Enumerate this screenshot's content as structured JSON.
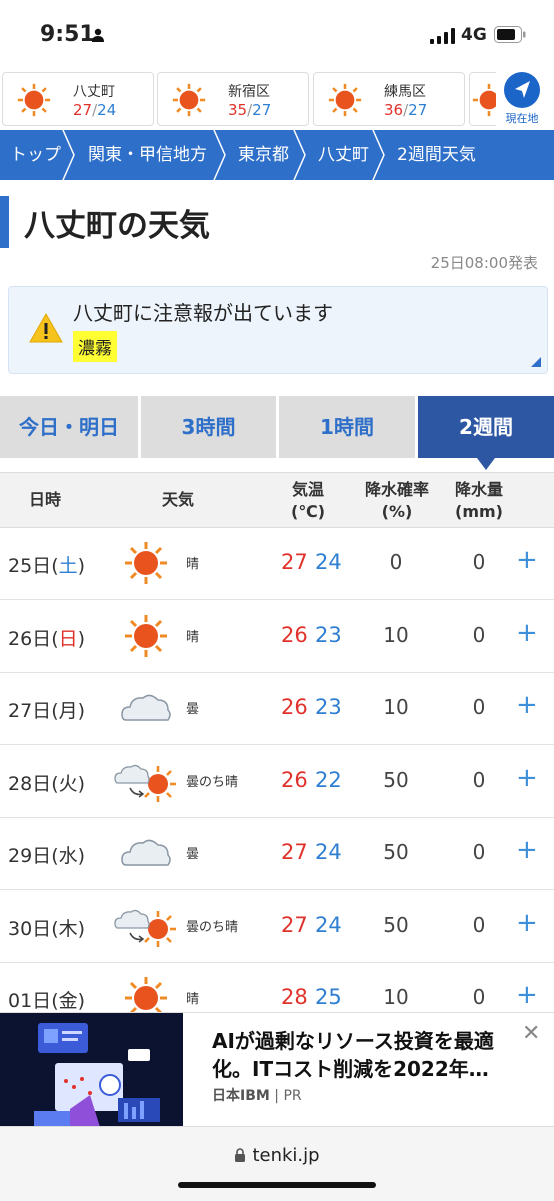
{
  "status_bar": {
    "time": "9:51",
    "network": "4G"
  },
  "locations": [
    {
      "name": "八丈町",
      "high": "27",
      "low": "24"
    },
    {
      "name": "新宿区",
      "high": "35",
      "low": "27"
    },
    {
      "name": "練馬区",
      "high": "36",
      "low": "27"
    }
  ],
  "current_location_label": "現在地",
  "breadcrumb": [
    "トップ",
    "関東・甲信地方",
    "東京都",
    "八丈町",
    "2週間天気"
  ],
  "page_title": "八丈町の天気",
  "issued": "25日08:00発表",
  "alert": {
    "message": "八丈町に注意報が出ています",
    "badge": "濃霧"
  },
  "tabs": [
    {
      "label": "今日・明日",
      "active": false
    },
    {
      "label": "3時間",
      "active": false
    },
    {
      "label": "1時間",
      "active": false
    },
    {
      "label": "2週間",
      "active": true
    }
  ],
  "table_header": {
    "date": "日時",
    "weather": "天気",
    "temp_line1": "気温",
    "temp_line2": "(℃)",
    "prob_line1": "降水確率",
    "prob_line2": "(%)",
    "amount_line1": "降水量",
    "amount_line2": "(mm)"
  },
  "forecast": [
    {
      "day": "25日",
      "weekday": "土",
      "weekday_type": "sat",
      "icon": "sunny-icon",
      "weather": "晴",
      "high": "27",
      "low": "24",
      "prob": "0",
      "amount": "0"
    },
    {
      "day": "26日",
      "weekday": "日",
      "weekday_type": "sun",
      "icon": "sunny-icon",
      "weather": "晴",
      "high": "26",
      "low": "23",
      "prob": "10",
      "amount": "0"
    },
    {
      "day": "27日",
      "weekday": "月",
      "weekday_type": "normal",
      "icon": "cloudy-icon",
      "weather": "曇",
      "high": "26",
      "low": "23",
      "prob": "10",
      "amount": "0"
    },
    {
      "day": "28日",
      "weekday": "火",
      "weekday_type": "normal",
      "icon": "cloudy-then-sunny-icon",
      "weather": "曇のち晴",
      "high": "26",
      "low": "22",
      "prob": "50",
      "amount": "0"
    },
    {
      "day": "29日",
      "weekday": "水",
      "weekday_type": "normal",
      "icon": "cloudy-icon",
      "weather": "曇",
      "high": "27",
      "low": "24",
      "prob": "50",
      "amount": "0"
    },
    {
      "day": "30日",
      "weekday": "木",
      "weekday_type": "normal",
      "icon": "cloudy-then-sunny-icon",
      "weather": "曇のち晴",
      "high": "27",
      "low": "24",
      "prob": "50",
      "amount": "0"
    },
    {
      "day": "01日",
      "weekday": "金",
      "weekday_type": "normal",
      "icon": "sunny-icon",
      "weather": "晴",
      "high": "28",
      "low": "25",
      "prob": "10",
      "amount": "0"
    }
  ],
  "ad": {
    "headline": "AIが過剰なリソース投資を最適化。ITコスト削減を2022年…",
    "sponsor": "日本IBM",
    "pr_label": "PR"
  },
  "url_bar": {
    "domain": "tenki.jp"
  }
}
